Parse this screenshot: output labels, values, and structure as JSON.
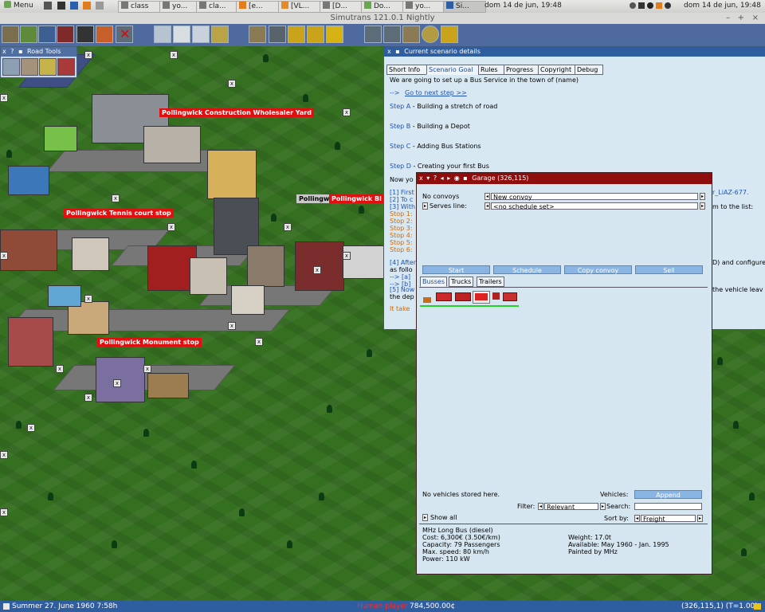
{
  "taskbar": {
    "menu_label": "Menu",
    "items": [
      "class",
      "yo...",
      "cla...",
      "[e...",
      "[VL...",
      "[D...",
      "Do...",
      "yo...",
      "Si..."
    ],
    "clock_left": "dom 14 de jun, 19:48",
    "clock_right": "dom 14 de jun, 19:48"
  },
  "window": {
    "title": "Simutrans 121.0.1 Nightly",
    "controls": [
      "–",
      "+",
      "×"
    ]
  },
  "road_tools": {
    "title": "Road Tools"
  },
  "map_labels": {
    "construction_wholesaler": "Pollingwick Construction Wholesaler Yard",
    "tennis_court": "Pollingwick Tennis court stop",
    "monument": "Pollingwick Monument stop",
    "pollingwick_grey": "Pollingwi",
    "pollingwick_red": "Pollingwick Bl"
  },
  "scenario": {
    "title": "Current scenario details",
    "tabs": [
      "Short Info",
      "Scenario Goal",
      "Rules",
      "Progress",
      "Copyright",
      "Debug"
    ],
    "active_tab": "Scenario Goal",
    "intro": "We are going to set up a Bus Service in the town of (name)",
    "next_step_arrow": "-->",
    "next_step_link": "Go to next step >>",
    "steps": [
      {
        "id": "Step A",
        "text": " - Building a stretch of road"
      },
      {
        "id": "Step B",
        "text": " - Building a Depot"
      },
      {
        "id": "Step C",
        "text": " - Adding Bus Stations"
      },
      {
        "id": "Step D",
        "text": " - Creating your first Bus"
      }
    ],
    "now_line": "Now yo",
    "bullet1": "[1] First",
    "bullet2": "[2] To c",
    "bullet3": "[3] With",
    "bullet3_right": "m to the list:",
    "bullet_right_liaz": "r_LiAZ-677.",
    "stops": [
      "Stop 1:",
      "Stop 2:",
      "Stop 3:",
      "Stop 4:",
      "Stop 5:",
      "Stop 6:"
    ],
    "bullet4": "[4] After",
    "bullet4_right": "D) and configure",
    "as_follow": "as follo",
    "arrow_a": "--> [a]",
    "arrow_b": "--> [b]",
    "bullet5": "[5] Now",
    "bullet5_right": "the vehicle leav",
    "the_dep": "the dep",
    "it_takes": "It take"
  },
  "garage": {
    "title": "Garage (326,115)",
    "no_convoys_label": "No convoys",
    "convoy_value": "New convoy",
    "serves_line_label": "Serves line:",
    "serves_line_value": "<no schedule set>",
    "buttons": {
      "start": "Start",
      "schedule": "Schedule",
      "copy": "Copy convoy",
      "sell": "Sell"
    },
    "tabs": [
      "Busses",
      "Trucks",
      "Trailers"
    ],
    "active_tab": "Busses",
    "no_vehicles": "No vehicles stored here.",
    "vehicles_label": "Vehicles:",
    "append_button": "Append",
    "filter_label": "Filter:",
    "filter_value": "Relevant",
    "search_label": "Search:",
    "search_value": "",
    "show_all_label": "Show all",
    "sort_by_label": "Sort by:",
    "sort_by_value": "Freight",
    "vehicle_info": {
      "name": "MHz Long Bus (diesel)",
      "cost": "Cost:    6,300€ (3.50€/km)",
      "capacity": "Capacity:  79 Passengers",
      "max_speed": "Max. speed:  80 km/h",
      "power": "Power:  110 kW",
      "weight": "Weight: 17.0t",
      "available": "Available: May 1960 - Jan. 1995",
      "painted_by": "Painted by MHz"
    }
  },
  "statusbar": {
    "date": "Summer 27. June 1960  7:58h",
    "player": "Human player",
    "money": "784,500.00¢",
    "coords": "(326,115,1) (T=1.00)"
  },
  "colors": {
    "title_blue": "#2e5da0",
    "garage_red": "#8e0d0d",
    "button_blue": "#8ab4e2",
    "label_red": "#e01010",
    "grass": "#356f20"
  }
}
